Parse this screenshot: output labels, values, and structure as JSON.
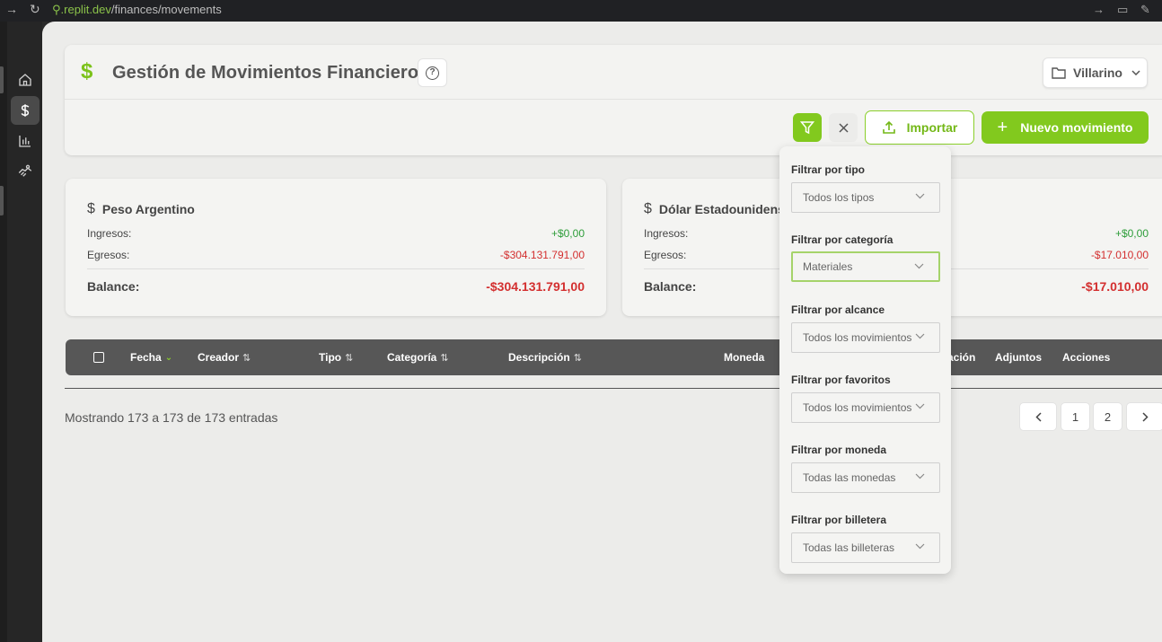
{
  "browser": {
    "url_prefix": ".replit.dev",
    "url_path": "/finances/movements"
  },
  "sidebar": {
    "items": [
      {
        "name": "home",
        "icon": "home-icon"
      },
      {
        "name": "finances",
        "icon": "dollar-icon",
        "active": true
      },
      {
        "name": "reports",
        "icon": "bar-chart-icon"
      },
      {
        "name": "handshake",
        "icon": "handshake-icon"
      }
    ]
  },
  "header": {
    "title": "Gestión de Movimientos Financieros",
    "workspace": "Villarino",
    "import_label": "Importar",
    "new_label": "Nuevo movimiento"
  },
  "balances": [
    {
      "currency": "Peso Argentino",
      "income_label": "Ingresos:",
      "income": "+$0,00",
      "expense_label": "Egresos:",
      "expense": "-$304.131.791,00",
      "balance_label": "Balance:",
      "balance": "-$304.131.791,00"
    },
    {
      "currency": "Dólar Estadounidense",
      "income_label": "Ingresos:",
      "income": "+$0,00",
      "expense_label": "Egresos:",
      "expense": "-$17.010,00",
      "balance_label": "Balance:",
      "balance": "-$17.010,00"
    }
  ],
  "table": {
    "columns": {
      "fecha": "Fecha",
      "creador": "Creador",
      "tipo": "Tipo",
      "categoria": "Categoría",
      "descripcion": "Descripción",
      "moneda": "Moneda",
      "valoracion": "ación",
      "adjuntos": "Adjuntos",
      "acciones": "Acciones"
    },
    "footer": "Mostrando 173 a 173 de 173 entradas",
    "pages": [
      "1",
      "2"
    ]
  },
  "filters": {
    "tipo": {
      "label": "Filtrar por tipo",
      "value": "Todos los tipos"
    },
    "categoria": {
      "label": "Filtrar por categoría",
      "value": "Materiales"
    },
    "alcance": {
      "label": "Filtrar por alcance",
      "value": "Todos los movimientos"
    },
    "favoritos": {
      "label": "Filtrar por favoritos",
      "value": "Todos los movimientos"
    },
    "moneda": {
      "label": "Filtrar por moneda",
      "value": "Todas las monedas"
    },
    "billetera": {
      "label": "Filtrar por billetera",
      "value": "Todas las billeteras"
    }
  },
  "colors": {
    "accent": "#82c91e",
    "positive": "#2e9d3a",
    "negative": "#d32f2f",
    "table_header": "#575757"
  }
}
